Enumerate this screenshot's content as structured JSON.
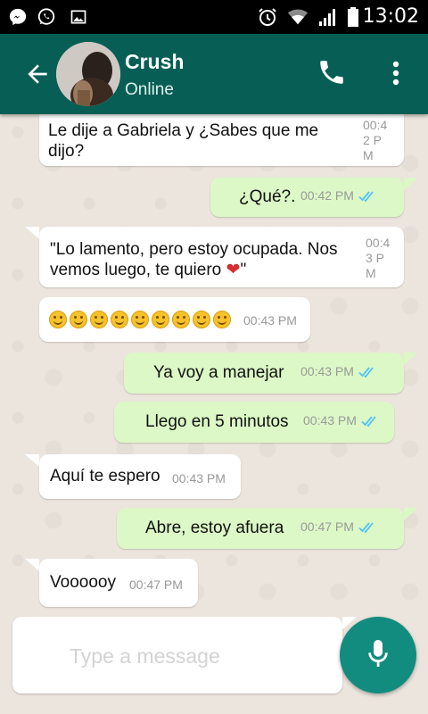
{
  "status_bar": {
    "time": "13:02",
    "left_icons": [
      "messenger-icon",
      "whatsapp-icon",
      "gallery-icon"
    ],
    "right_icons": [
      "alarm-icon",
      "wifi-icon",
      "signal-icon",
      "battery-icon"
    ]
  },
  "header": {
    "contact_name": "Crush",
    "contact_status": "Online",
    "icons": [
      "back-arrow-icon",
      "call-icon",
      "more-vert-icon"
    ]
  },
  "messages": [
    {
      "direction": "in",
      "text": "Le dije a Gabriela y ¿Sabes que me dijo?",
      "time": "00:42 PM"
    },
    {
      "direction": "out",
      "text": "¿Qué?.",
      "time": "00:42 PM",
      "read": true
    },
    {
      "direction": "in",
      "text": "\"Lo lamento, pero estoy ocupada. Nos vemos luego, te quiero",
      "emoji_tail": "❤",
      "text_end": "\"",
      "time": "00:43 PM"
    },
    {
      "direction": "in",
      "text": "",
      "emoji": "smiling-face",
      "emoji_count": 9,
      "time": "00:43 PM"
    },
    {
      "direction": "out",
      "text": "Ya voy a manejar",
      "time": "00:43 PM",
      "read": true
    },
    {
      "direction": "out",
      "text": "Llego en 5 minutos",
      "time": "00:43 PM",
      "read": true
    },
    {
      "direction": "in",
      "text": "Aquí te espero",
      "time": "00:43 PM"
    },
    {
      "direction": "out",
      "text": "Abre, estoy afuera",
      "time": "00:47 PM",
      "read": true
    },
    {
      "direction": "in",
      "text": "Voooooy",
      "time": "00:47 PM"
    }
  ],
  "composer": {
    "placeholder": "Type a message",
    "mic_icon": "mic-icon"
  },
  "colors": {
    "header": "#075e54",
    "outgoing_bubble": "#dcf8c6",
    "incoming_bubble": "#ffffff",
    "read_ticks": "#4fc3f7",
    "mic_button": "#128c7e",
    "chat_background": "#ece5dd"
  }
}
